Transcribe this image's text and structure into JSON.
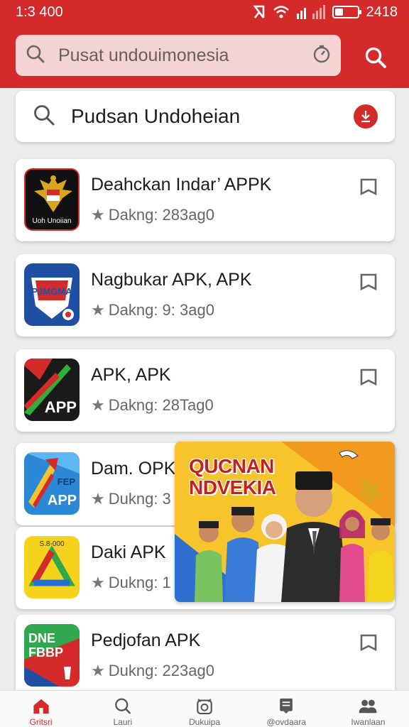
{
  "status_bar": {
    "time": "1:3 400",
    "battery_text": "2418",
    "battery_level": 0.35
  },
  "app_bar": {
    "search_placeholder": "Pusat undouimonesia"
  },
  "search": {
    "value": "Pudsan Undoheian"
  },
  "apps": [
    {
      "name": "Deahckan Indar’ APPK",
      "rating": "Dakng: 283ag0",
      "icon": "garuda-emblem-icon",
      "icon_caption": "Uoh Unoiian"
    },
    {
      "name": "Nagbukar APK, APK",
      "rating": "Dakng: 9: 3ag0",
      "icon": "shield-logo-icon",
      "icon_caption": "PJMGMA"
    },
    {
      "name": "APK, APK",
      "rating": "Dakng: 28Tag0",
      "icon": "app-arrow-icon",
      "icon_caption": "APP"
    },
    {
      "name": "Dam. OPK",
      "rating": "Dukng: 3",
      "icon": "growth-arrow-icon",
      "icon_caption": "APP",
      "icon_badge": "FEP"
    },
    {
      "name": "Daki APK",
      "rating": "Dukng: 1",
      "icon": "drive-triangle-icon",
      "icon_caption": "S.8-000"
    },
    {
      "name": "Pedjofan APK",
      "rating": "Dukng: 223ag0",
      "icon": "flag-poster-icon",
      "icon_caption": "DNE FBBP"
    }
  ],
  "promo": {
    "title_line1": "QUCNAN",
    "title_line2": "NDVEKIA"
  },
  "nav": [
    {
      "label": "Gritsri",
      "icon": "home-icon",
      "active": true
    },
    {
      "label": "Lauri",
      "icon": "search-icon",
      "active": false
    },
    {
      "label": "Dukuipa",
      "icon": "alarm-icon",
      "active": false
    },
    {
      "label": "@ovdaara",
      "icon": "document-icon",
      "active": false
    },
    {
      "label": "Iwanlaan",
      "icon": "people-icon",
      "active": false
    }
  ],
  "colors": {
    "brand_red": "#d42a2a",
    "search_tint": "#f4d4d2",
    "promo_yellow": "#f7c42b"
  }
}
